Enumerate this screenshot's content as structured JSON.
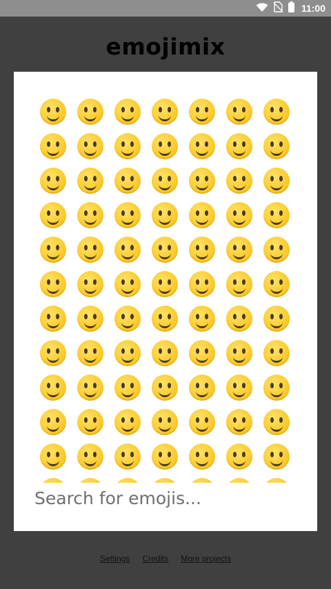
{
  "status_bar": {
    "time": "11:00",
    "icons": [
      "wifi-icon",
      "no-sim-icon",
      "battery-icon"
    ]
  },
  "app": {
    "title": "emojimix"
  },
  "emoji_grid": {
    "emojis": [
      "😄",
      "😀",
      "🙂",
      "🙃",
      "😃",
      "😁",
      "😊",
      "☺️",
      "😇",
      "😆",
      "😂",
      "🤣",
      "😅",
      "😉",
      "😗",
      "😙",
      "😚",
      "😘",
      "😍",
      "🥰",
      "🤩",
      "😛",
      "😝",
      "😋",
      "😜",
      "🤪",
      "🤑",
      "🥲",
      "🤗",
      "🤫",
      "🤭",
      "🫢",
      "🫣",
      "🤐",
      "😶",
      "🤔",
      "🤨",
      "😐",
      "😑",
      "😶‍🌫️",
      "😏",
      "😌",
      "😬",
      "🙄",
      "😒",
      "☹️",
      "😮‍💨",
      "😞",
      "😔",
      "🤥",
      "🥱",
      "😪",
      "😴",
      "🤤",
      "😷",
      "🤒",
      "🤕",
      "🤢",
      "🤮",
      "🤧",
      "🥵",
      "🥶",
      "😵",
      "🥴",
      "🫠",
      "🤯",
      "🤠",
      "🥳",
      "🥸",
      "🧐",
      "😎",
      "😕",
      "🫤",
      "😟",
      "🙁",
      "😮",
      "😯",
      "😲",
      "😳",
      "🥺",
      "🥹",
      "😦",
      "😧",
      "😨"
    ]
  },
  "search": {
    "placeholder": "Search for emojis..."
  },
  "footer": {
    "settings_label": "Settings",
    "credits_label": "Credits",
    "more_projects_label": "More projects"
  }
}
